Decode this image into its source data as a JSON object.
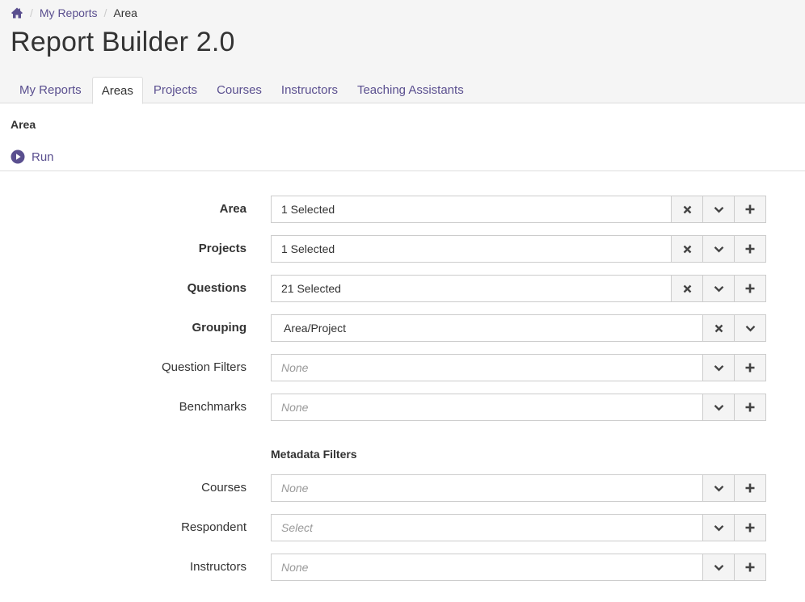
{
  "breadcrumb": {
    "home_icon": "home-icon",
    "items": [
      "My Reports",
      "Area"
    ]
  },
  "page": {
    "title": "Report Builder 2.0"
  },
  "tabs": [
    {
      "label": "My Reports",
      "active": false
    },
    {
      "label": "Areas",
      "active": true
    },
    {
      "label": "Projects",
      "active": false
    },
    {
      "label": "Courses",
      "active": false
    },
    {
      "label": "Instructors",
      "active": false
    },
    {
      "label": "Teaching Assistants",
      "active": false
    }
  ],
  "section": {
    "title": "Area",
    "run_label": "Run",
    "run_icon": "play-circle-icon"
  },
  "form": {
    "rows": [
      {
        "label": "Area",
        "value": "1 Selected",
        "placeholder": false,
        "buttons": [
          "clear",
          "toggle",
          "add"
        ]
      },
      {
        "label": "Projects",
        "value": "1 Selected",
        "placeholder": false,
        "buttons": [
          "clear",
          "toggle",
          "add"
        ]
      },
      {
        "label": "Questions",
        "value": "21 Selected",
        "placeholder": false,
        "buttons": [
          "clear",
          "toggle",
          "add"
        ]
      },
      {
        "label": "Grouping",
        "value": "Area/Project",
        "placeholder": false,
        "buttons": [
          "clear",
          "toggle"
        ]
      },
      {
        "label": "Question Filters",
        "value": "None",
        "placeholder": true,
        "buttons": [
          "toggle",
          "add"
        ]
      },
      {
        "label": "Benchmarks",
        "value": "None",
        "placeholder": true,
        "buttons": [
          "toggle",
          "add"
        ]
      }
    ],
    "metadata_title": "Metadata Filters",
    "metadata_rows": [
      {
        "label": "Courses",
        "value": "None",
        "placeholder": true,
        "buttons": [
          "toggle",
          "add"
        ]
      },
      {
        "label": "Respondent",
        "value": "Select",
        "placeholder": true,
        "buttons": [
          "toggle",
          "add"
        ]
      },
      {
        "label": "Instructors",
        "value": "None",
        "placeholder": true,
        "buttons": [
          "toggle",
          "add"
        ]
      }
    ]
  },
  "colors": {
    "accent": "#5a4f8f",
    "header_bg": "#f5f5f5",
    "border": "#cccccc",
    "button_bg": "#f4f4f4"
  }
}
